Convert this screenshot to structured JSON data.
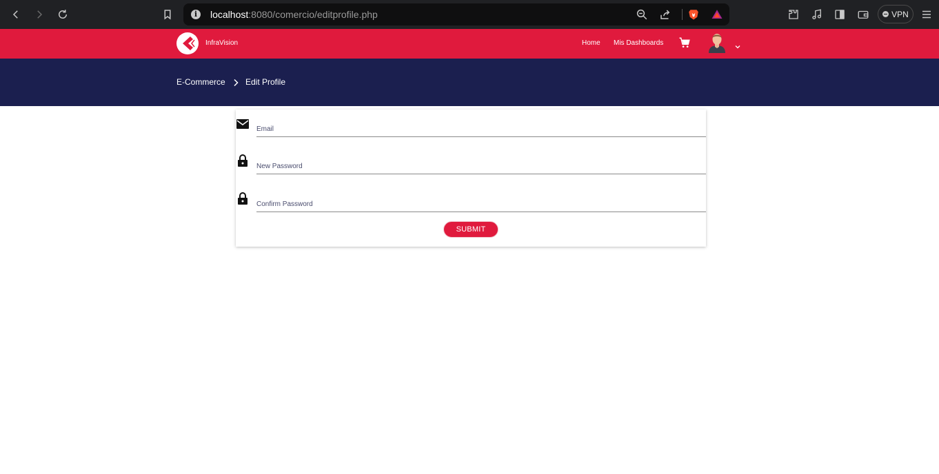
{
  "browser": {
    "url_host": "localhost",
    "url_rest": ":8080/comercio/editprofile.php",
    "vpn_label": "VPN"
  },
  "header": {
    "brand": "InfraVision",
    "nav": [
      "Home",
      "Mis Dashboards"
    ],
    "brand_color": "#e01a3d"
  },
  "breadcrumb": {
    "items": [
      "E-Commerce",
      "Edit Profile"
    ],
    "bg_color": "#1b1f4f"
  },
  "form": {
    "fields": [
      {
        "icon": "mail-icon",
        "placeholder": "Email",
        "value": ""
      },
      {
        "icon": "lock-icon",
        "placeholder": "New Password",
        "value": ""
      },
      {
        "icon": "lock-icon",
        "placeholder": "Confirm Password",
        "value": ""
      }
    ],
    "submit_label": "SUBMIT"
  }
}
